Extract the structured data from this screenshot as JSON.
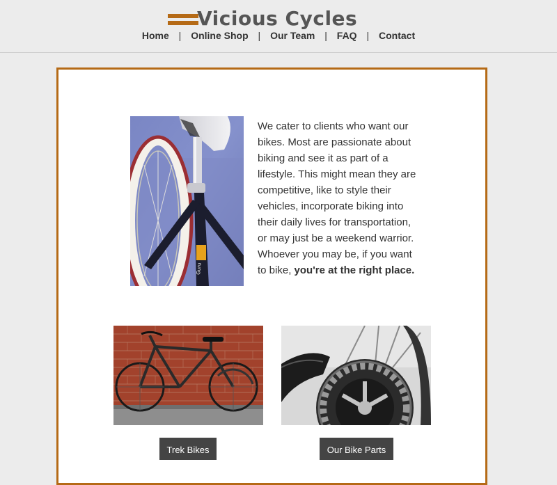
{
  "brand": {
    "name": "Vicious Cycles",
    "accent_color": "#b56a16"
  },
  "nav": {
    "items": [
      {
        "label": "Home"
      },
      {
        "label": "Online Shop"
      },
      {
        "label": "Our Team"
      },
      {
        "label": "FAQ"
      },
      {
        "label": "Contact"
      }
    ],
    "separator": "|"
  },
  "intro": {
    "text": "We cater to clients who want our bikes. Most are passionate about biking and see it as part of a lifestyle. This might mean they are competitive, like to style their vehicles, incorporate biking into their daily lives for transportation, or may just be a weekend warrior. Whoever you may be, if you want to bike,",
    "emphasis": "you're at the right place."
  },
  "features": [
    {
      "button_label": "Trek Bikes"
    },
    {
      "button_label": "Our Bike Parts"
    }
  ]
}
